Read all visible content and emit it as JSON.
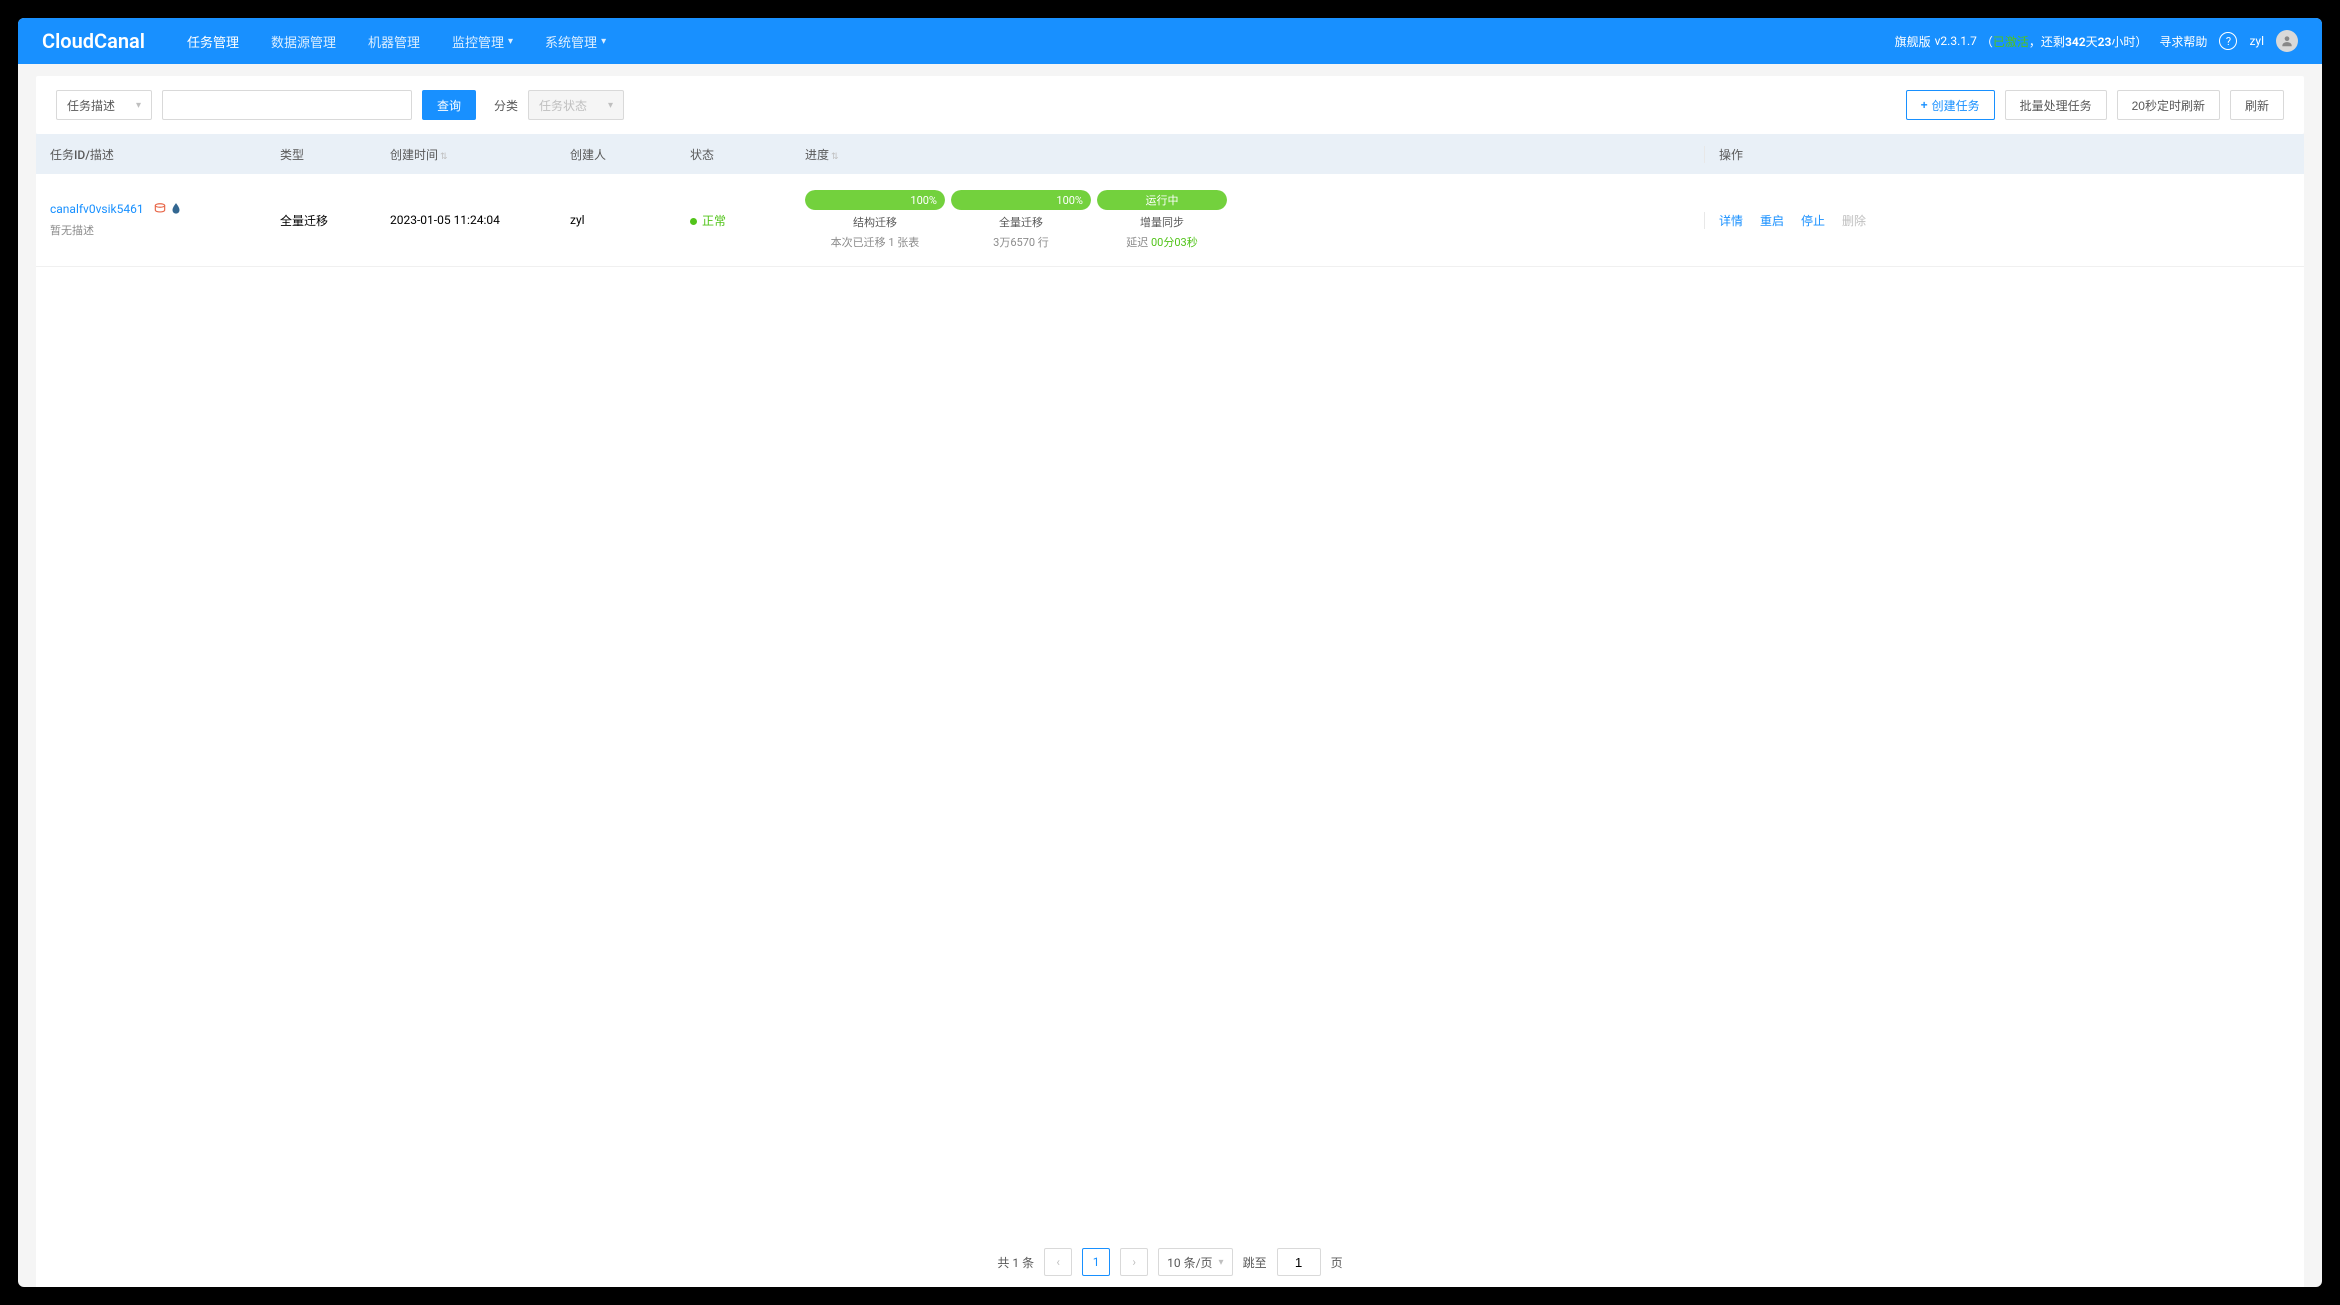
{
  "header": {
    "logo": "CloudCanal",
    "nav": [
      {
        "label": "任务管理",
        "active": true,
        "caret": false
      },
      {
        "label": "数据源管理",
        "active": false,
        "caret": false
      },
      {
        "label": "机器管理",
        "active": false,
        "caret": false
      },
      {
        "label": "监控管理",
        "active": false,
        "caret": true
      },
      {
        "label": "系统管理",
        "active": false,
        "caret": true
      }
    ],
    "edition": "旗舰版",
    "version": "v2.3.1.7",
    "activated": "已激活",
    "remaining_prefix": "，还剩",
    "remaining_days": "342",
    "remaining_days_unit": "天",
    "remaining_hours": "23",
    "remaining_hours_unit": "小时",
    "help": "寻求帮助",
    "user": "zyl"
  },
  "toolbar": {
    "filter_type": "任务描述",
    "search_btn": "查询",
    "category_label": "分类",
    "category_placeholder": "任务状态",
    "create_btn": "创建任务",
    "batch_btn": "批量处理任务",
    "timer_btn": "20秒定时刷新",
    "refresh_btn": "刷新"
  },
  "table": {
    "headers": {
      "id": "任务ID/描述",
      "type": "类型",
      "time": "创建时间",
      "creator": "创建人",
      "status": "状态",
      "progress": "进度",
      "actions": "操作"
    },
    "rows": [
      {
        "task_id": "canalfv0vsik5461",
        "desc": "暂无描述",
        "type": "全量迁移",
        "time": "2023-01-05 11:24:04",
        "creator": "zyl",
        "status": "正常",
        "progress": [
          {
            "pct": "100%",
            "title": "结构迁移",
            "detail": "本次已迁移 1 张表"
          },
          {
            "pct": "100%",
            "title": "全量迁移",
            "detail": "3万6570 行"
          },
          {
            "pct_label": "运行中",
            "title": "增量同步",
            "delay_label": "延迟",
            "delay_value": "00分03秒"
          }
        ],
        "actions": {
          "detail": "详情",
          "restart": "重启",
          "stop": "停止",
          "delete": "删除"
        }
      }
    ]
  },
  "pagination": {
    "total_prefix": "共",
    "total_count": "1",
    "total_suffix": "条",
    "current": "1",
    "page_size": "10 条/页",
    "jump_label": "跳至",
    "jump_value": "1",
    "jump_suffix": "页"
  }
}
